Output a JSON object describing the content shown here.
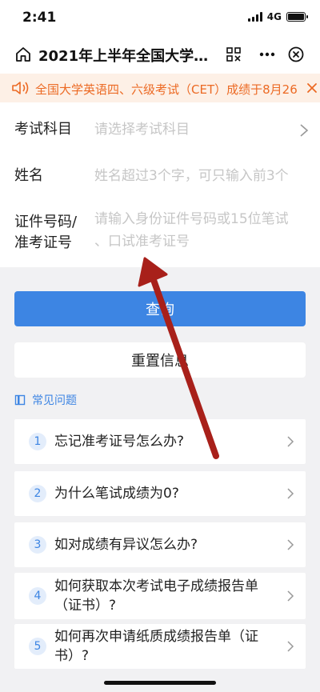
{
  "status_bar": {
    "time": "2:41",
    "network": "4G"
  },
  "nav": {
    "title": "2021年上半年全国大学…",
    "icons": [
      "home-icon",
      "qr-scan-icon",
      "more-icon",
      "close-icon"
    ]
  },
  "notice": {
    "text": "全国大学英语四、六级考试（CET）成绩于8月26",
    "icon": "speaker-icon"
  },
  "form": {
    "subject": {
      "label": "考试科目",
      "placeholder": "请选择考试科目"
    },
    "name": {
      "label": "姓名",
      "placeholder": "姓名超过3个字，可只输入前3个"
    },
    "id": {
      "label_line1": "证件号码/",
      "label_line2": "准考证号",
      "placeholder_line1": "请输入身份证件号码或15位笔试",
      "placeholder_line2": "、口试准考证号"
    }
  },
  "buttons": {
    "query": "查询",
    "reset": "重置信息"
  },
  "faq": {
    "title": "常见问题",
    "items": [
      {
        "num": "1",
        "line1": "忘记准考证号怎么办?",
        "line2": ""
      },
      {
        "num": "2",
        "line1": "为什么笔试成绩为0?",
        "line2": ""
      },
      {
        "num": "3",
        "line1": "如对成绩有异议怎么办?",
        "line2": ""
      },
      {
        "num": "4",
        "line1": "如何获取本次考试电子成绩报告单",
        "line2": "（证书）?"
      },
      {
        "num": "5",
        "line1": "如何再次申请纸质成绩报告单（证",
        "line2": "书）?"
      }
    ]
  },
  "colors": {
    "accent": "#3d85e3",
    "notice": "#ec6a24",
    "notice_bg": "#fdf0e6",
    "annotation_arrow": "#a8201a"
  }
}
